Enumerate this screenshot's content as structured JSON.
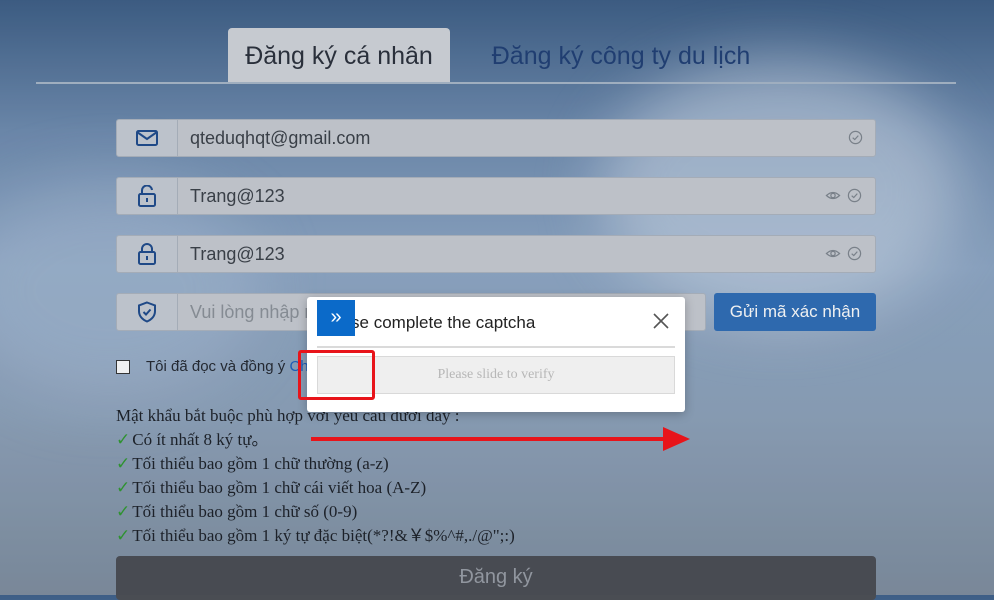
{
  "tabs": [
    {
      "label": "Đăng ký cá nhân",
      "active": true
    },
    {
      "label": "Đăng ký công ty du lịch",
      "active": false
    }
  ],
  "form": {
    "email": {
      "value": "qteduqhqt@gmail.com",
      "icon": "mail-icon"
    },
    "password": {
      "value": "Trang@123",
      "icon": "lock-open-icon"
    },
    "confirm_password": {
      "value": "Trang@123",
      "icon": "lock-icon"
    },
    "code": {
      "placeholder": "Vui lòng nhập mã xác nhận",
      "visible_text": "Vui lòng nhập n",
      "icon": "shield-icon"
    },
    "send_code_label": "Gửi mã xác nhận",
    "agree_text": "Tôi đã đọc và đồng ý",
    "agree_link": "Chi",
    "submit_label": "Đăng ký"
  },
  "requirements": {
    "heading": "Mật khẩu bắt buộc phù hợp với yêu cầu dưới đây :",
    "items": [
      "Có ít nhất 8 ký tự。",
      "Tối thiểu bao gồm 1 chữ thường (a-z)",
      "Tối thiểu bao gồm 1 chữ cái viết hoa (A-Z)",
      "Tối thiểu bao gồm 1 chữ số (0-9)",
      "Tối thiểu bao gồm 1 ký tự đặc biệt(*?!&￥$%^#,./@\";:)"
    ]
  },
  "captcha": {
    "title": "Please complete the captcha",
    "slider_text": "Please slide to verify",
    "handle_glyph": "»"
  },
  "colors": {
    "accent": "#2e6db7",
    "handle": "#0b6ac9",
    "annotation": "#e8141a",
    "check": "#2f9a2f"
  }
}
